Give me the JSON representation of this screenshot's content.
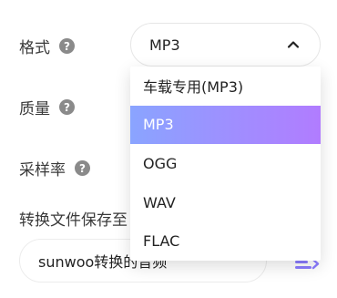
{
  "settings": {
    "format_label": "格式",
    "quality_label": "质量",
    "sample_rate_label": "采样率",
    "save_to_label": "转换文件保存至",
    "help_glyph": "?"
  },
  "format_select": {
    "value": "MP3",
    "options": [
      "车载专用(MP3)",
      "MP3",
      "OGG",
      "WAV",
      "FLAC"
    ],
    "selected_index": 1
  },
  "output_path": {
    "value": "sunwoo转换的音频"
  },
  "colors": {
    "selected_gradient_start": "#8aa4ff",
    "selected_gradient_end": "#b17cff",
    "folder_icon": "#8b7cff"
  }
}
